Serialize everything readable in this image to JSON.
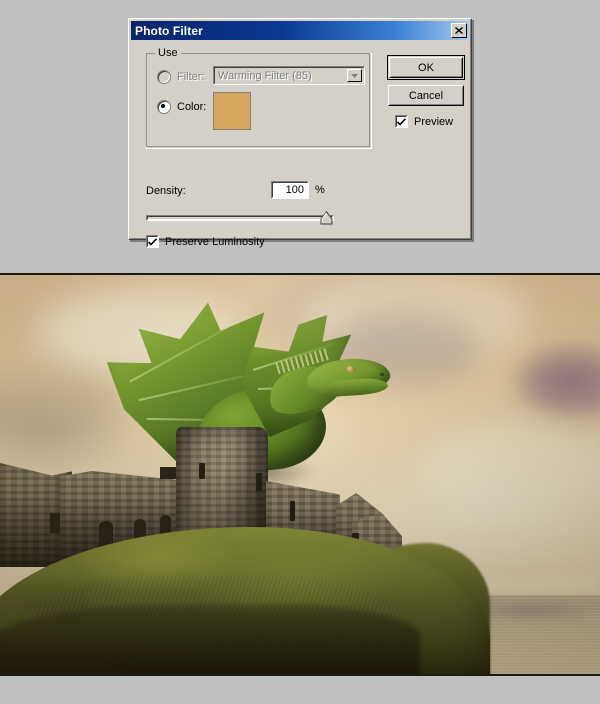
{
  "window": {
    "title": "Photo Filter",
    "close_icon": "close-x-icon"
  },
  "group": {
    "legend": "Use"
  },
  "options": {
    "filter": {
      "label": "Filter:",
      "selected": false,
      "enabled": false,
      "combo_value": "Warming Filter (85)",
      "combo_arrow_icon": "chevron-down-icon"
    },
    "color": {
      "label": "Color:",
      "selected": true,
      "enabled": true,
      "swatch_color": "#d6a55e"
    }
  },
  "density": {
    "label": "Density:",
    "value": "100",
    "unit": "%",
    "slider_percent": 100
  },
  "preserve_luminosity": {
    "label": "Preserve Luminosity",
    "checked": true,
    "check_icon": "checkmark-icon"
  },
  "buttons": {
    "ok": "OK",
    "cancel": "Cancel"
  },
  "preview": {
    "label": "Preview",
    "checked": true,
    "check_icon": "checkmark-icon"
  },
  "canvas": {
    "description": "Green dragon perched atop a ruined stone castle tower on a mossy cliff above the sea, warm sepia sky",
    "colors": {
      "desktop_background": "#c0c0c0",
      "sky_warm": "#f2dfb4",
      "dragon_green": "#6f9c26",
      "stone_gray": "#8b7f6a",
      "moss_green": "#6f7c30",
      "sea_haze": "#ddd0af"
    }
  }
}
